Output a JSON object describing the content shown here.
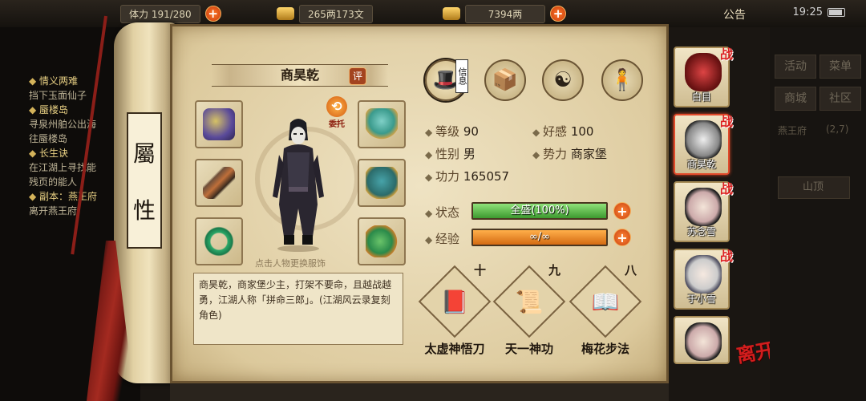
{
  "topbar": {
    "stamina": "体力 191/280",
    "silver": "265两173文",
    "gold": "7394两",
    "notice": "公告",
    "time": "19:25"
  },
  "quests": {
    "items": [
      {
        "title": "情义两难",
        "lines": [
          "挡下玉面仙子"
        ]
      },
      {
        "title": "蜃楼岛",
        "lines": [
          "寻泉州舶公出海",
          "往蜃楼岛"
        ]
      },
      {
        "title": "长生诀",
        "lines": [
          "在江湖上寻找能",
          "残页的能人"
        ]
      },
      {
        "title": "副本：燕王府",
        "lines": [
          "离开燕王府"
        ]
      }
    ]
  },
  "scroll": {
    "label_top": "屬",
    "label_bottom": "性"
  },
  "character": {
    "name": "商昊乾",
    "rate_badge": "评",
    "delegate_label": "委托",
    "hint": "点击人物更换服饰",
    "description": "商昊乾，商家堡少主，打架不要命，且越战越勇，江湖人称「拼命三郎」。(江湖风云录复刻角色)"
  },
  "tabs": {
    "info_label": "信息"
  },
  "stats": {
    "level_label": "等级",
    "level": "90",
    "favor_label": "好感",
    "favor": "100",
    "gender_label": "性别",
    "gender": "男",
    "faction_label": "势力",
    "faction": "商家堡",
    "power_label": "功力",
    "power": "165057",
    "state_label": "状态",
    "state_value": "全盛(100%)",
    "state_fill": 1.0,
    "exp_label": "经验",
    "exp_value": "∞/∞",
    "exp_fill": 1.0
  },
  "skills": [
    {
      "level": "十",
      "name": "太虚神悟刀"
    },
    {
      "level": "九",
      "name": "天一神功"
    },
    {
      "level": "八",
      "name": "梅花步法"
    }
  ],
  "roster": [
    {
      "name": "白目",
      "tag": "战"
    },
    {
      "name": "商昊乾",
      "tag": "战"
    },
    {
      "name": "苏念雪",
      "tag": "战"
    },
    {
      "name": "于小雪",
      "tag": "战"
    },
    {
      "name": "",
      "tag": ""
    }
  ],
  "leave_label": "离开",
  "side_menu": {
    "activity": "活动",
    "menu": "菜单",
    "shop": "商城",
    "community": "社区",
    "location": "燕王府",
    "coords": "(2,7)",
    "place": "山顶"
  },
  "colors": {
    "accent_red": "#d21d1d",
    "state_green": "#3d9a2f",
    "exp_orange": "#d46a12"
  }
}
